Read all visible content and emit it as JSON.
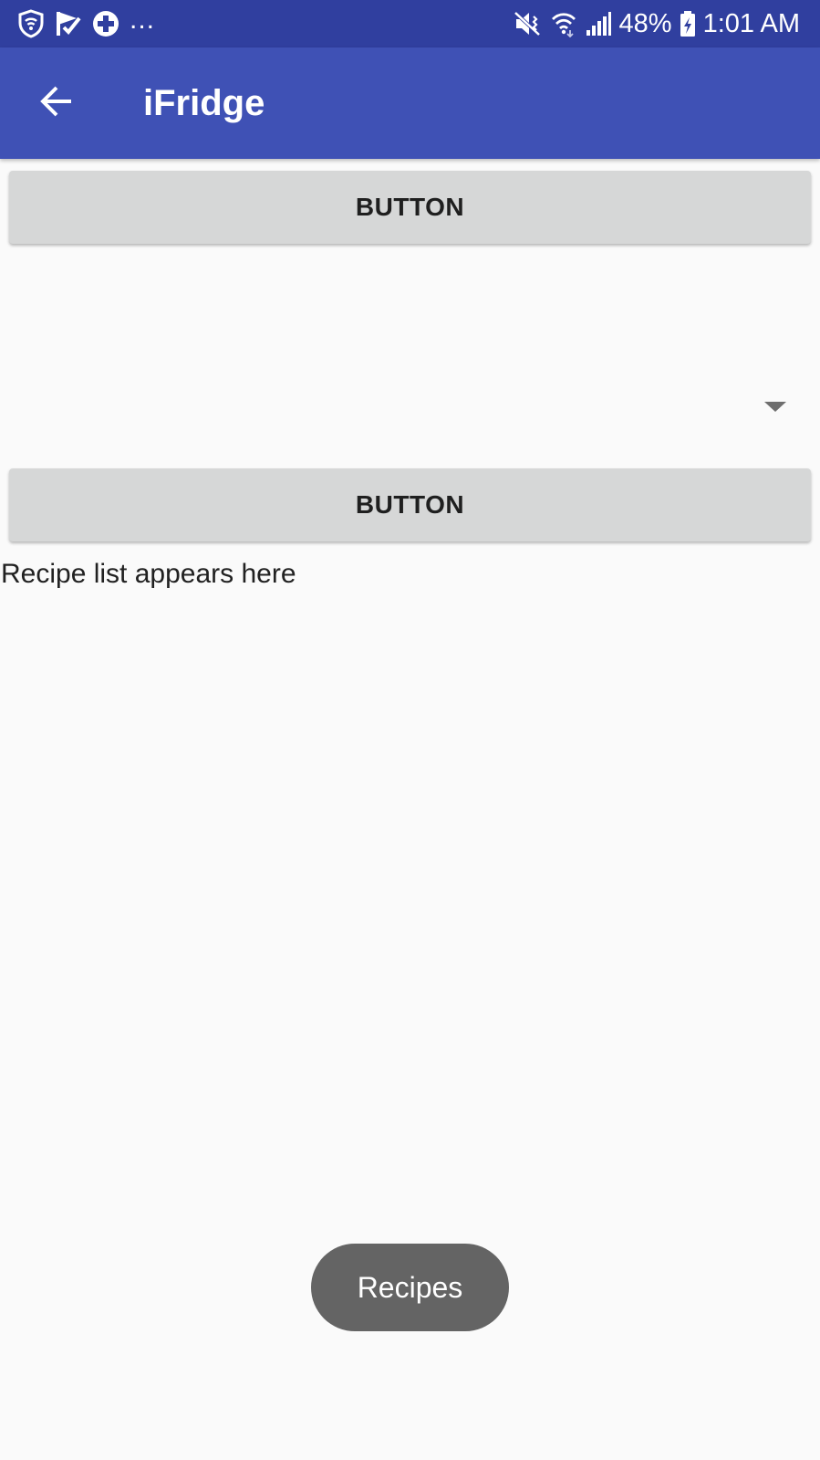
{
  "status_bar": {
    "left_icons": [
      "shield-icon",
      "checkmark-flag-icon",
      "plus-circle-icon"
    ],
    "overflow": "...",
    "right_icons": [
      "mute-vibrate-icon",
      "wifi-icon",
      "cellular-signal-icon",
      "battery-charging-icon"
    ],
    "battery_percent": "48%",
    "time": "1:01 AM",
    "color": "#303f9f"
  },
  "app_bar": {
    "title": "iFridge",
    "back_icon": "arrow-back-icon",
    "color": "#3f51b5"
  },
  "main": {
    "button_1_label": "BUTTON",
    "spinner_value": "",
    "button_2_label": "BUTTON",
    "recipe_placeholder": "Recipe list appears here"
  },
  "toast": {
    "text": "Recipes"
  }
}
